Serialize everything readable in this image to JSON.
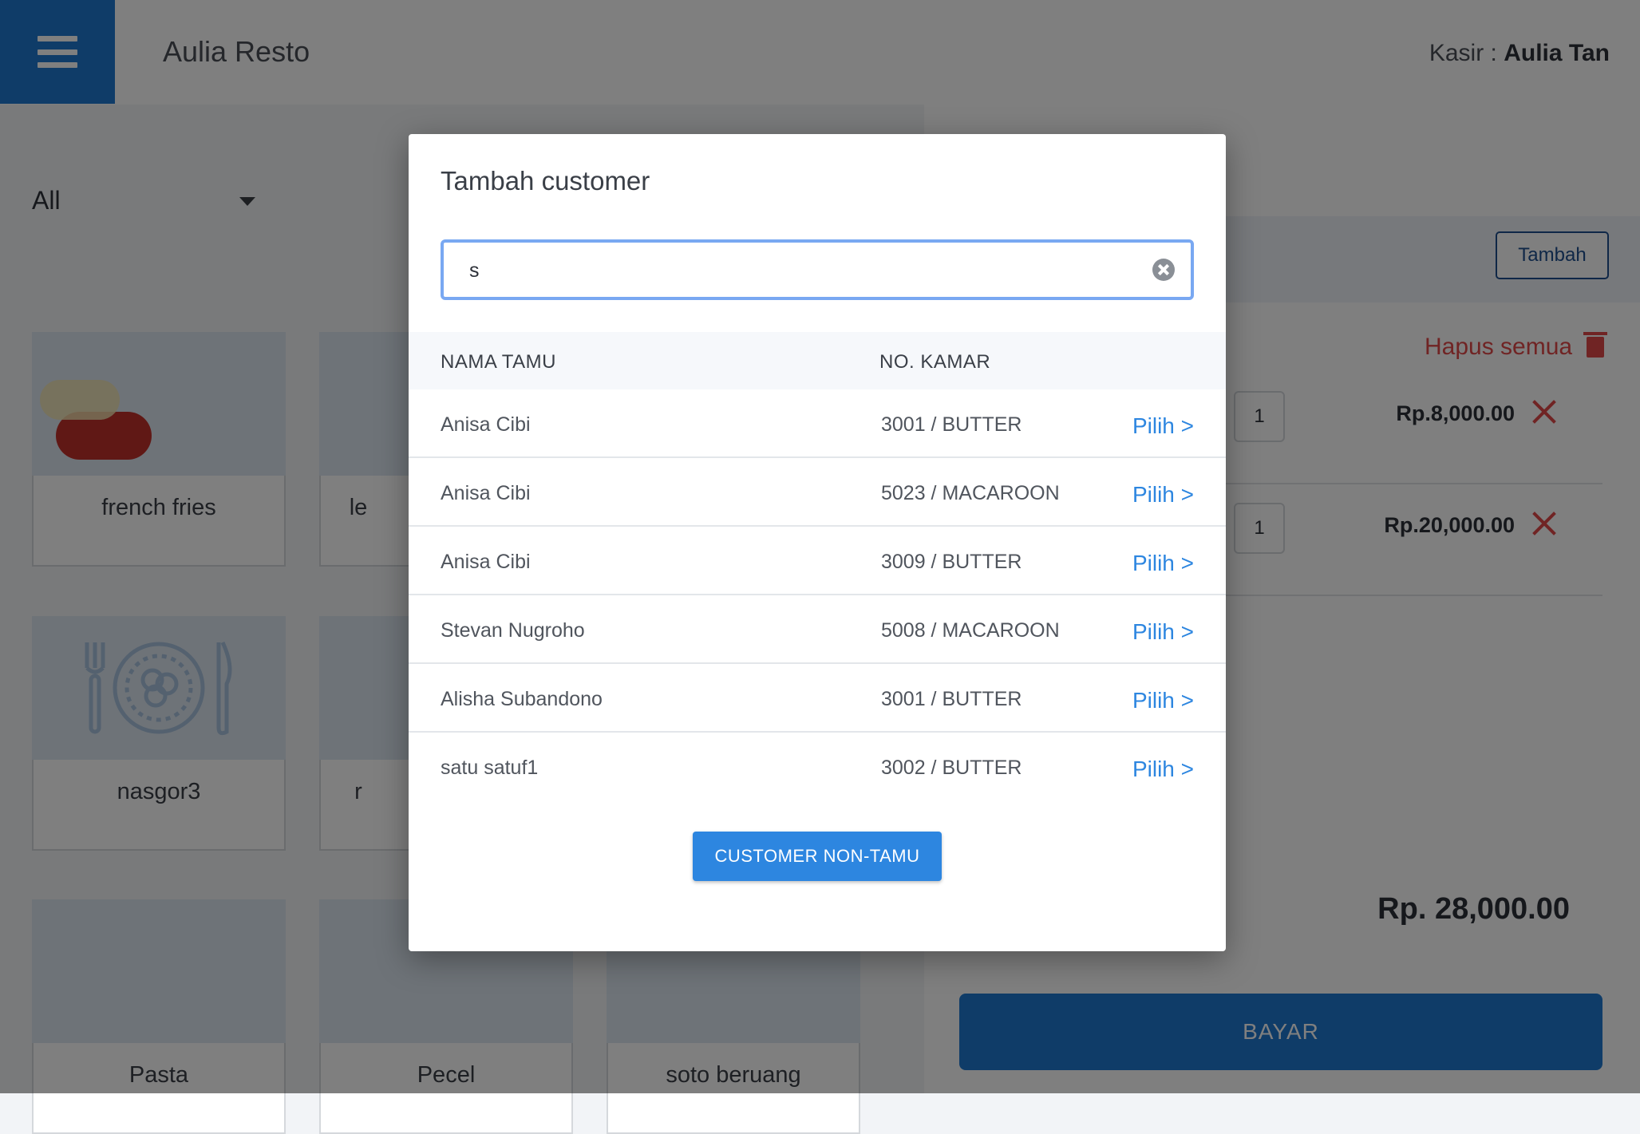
{
  "header": {
    "app_title": "Aulia Resto",
    "cashier_label": "Kasir : ",
    "cashier_name": "Aulia Tan"
  },
  "category": {
    "selected": "All"
  },
  "menu_items": [
    {
      "name": "french fries",
      "image": "photo-fries"
    },
    {
      "name": "le",
      "image": "photo-tea"
    },
    {
      "name": "nasgor3",
      "image": "plate-icon"
    },
    {
      "name": "r",
      "image": "plate-icon"
    },
    {
      "name": "Pasta",
      "image": "photo-pasta"
    },
    {
      "name": "Pecel",
      "image": "plate-icon"
    },
    {
      "name": "soto beruang",
      "image": "plate-icon"
    }
  ],
  "order": {
    "add_label": "Tambah",
    "clear_all_label": "Hapus semua",
    "rows": [
      {
        "qty": "1",
        "price": "Rp.8,000.00"
      },
      {
        "qty": "1",
        "price": "Rp.20,000.00"
      }
    ],
    "total": "Rp. 28,000.00",
    "pay_label": "BAYAR"
  },
  "modal": {
    "title": "Tambah customer",
    "search_value": "s",
    "columns": {
      "name": "NAMA TAMU",
      "room": "NO. KAMAR"
    },
    "guests": [
      {
        "name": "Anisa Cibi",
        "room": "3001 / BUTTER",
        "action": "Pilih >"
      },
      {
        "name": "Anisa Cibi",
        "room": "5023 / MACAROON",
        "action": "Pilih >"
      },
      {
        "name": "Anisa Cibi",
        "room": "3009 / BUTTER",
        "action": "Pilih >"
      },
      {
        "name": "Stevan Nugroho",
        "room": "5008 / MACAROON",
        "action": "Pilih >"
      },
      {
        "name": "Alisha Subandono",
        "room": "3001 / BUTTER",
        "action": "Pilih >"
      },
      {
        "name": "satu satuf1",
        "room": "3002 / BUTTER",
        "action": "Pilih >"
      }
    ],
    "non_guest_label": "CUSTOMER NON-TAMU"
  },
  "colors": {
    "primary": "#1f78d1",
    "link": "#2d86e0",
    "danger": "#e04848"
  }
}
